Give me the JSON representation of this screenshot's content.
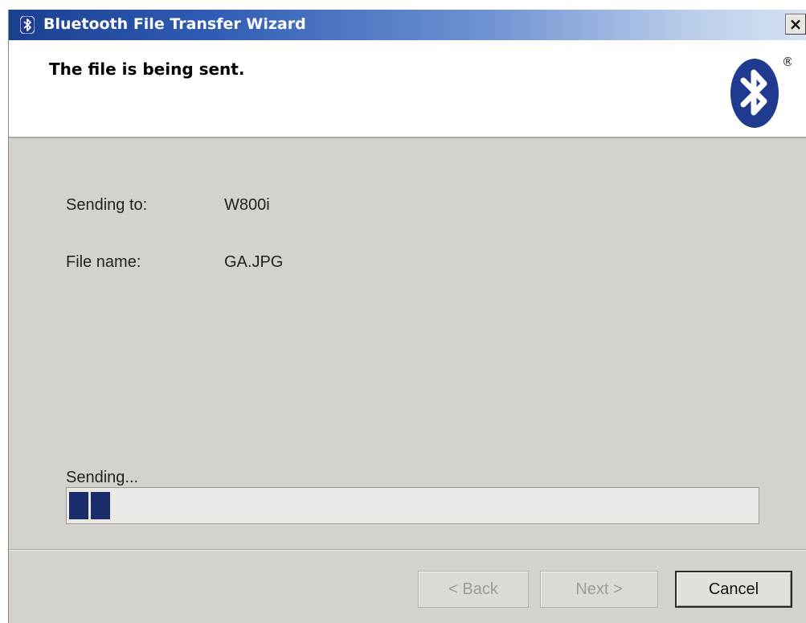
{
  "window": {
    "title": "Bluetooth File Transfer Wizard",
    "close_label": "×"
  },
  "header": {
    "title": "The file is being sent.",
    "logo_icon": "bluetooth-logo-icon",
    "logo_mark": "®"
  },
  "details": [
    {
      "label": "Sending to:",
      "value": "W800i"
    },
    {
      "label": "File name:",
      "value": "GA.JPG"
    }
  ],
  "progress": {
    "label": "Sending...",
    "fraction": 0.06,
    "color": "#1b2c6b"
  },
  "buttons": {
    "back": "< Back",
    "next": "Next >",
    "cancel": "Cancel"
  },
  "colors": {
    "title_bar_start": "#1a3f8f",
    "title_bar_end": "#d7e2f3",
    "dialog_bg": "#d5d2cd",
    "bluetooth_blue": "#1f3a8f"
  }
}
